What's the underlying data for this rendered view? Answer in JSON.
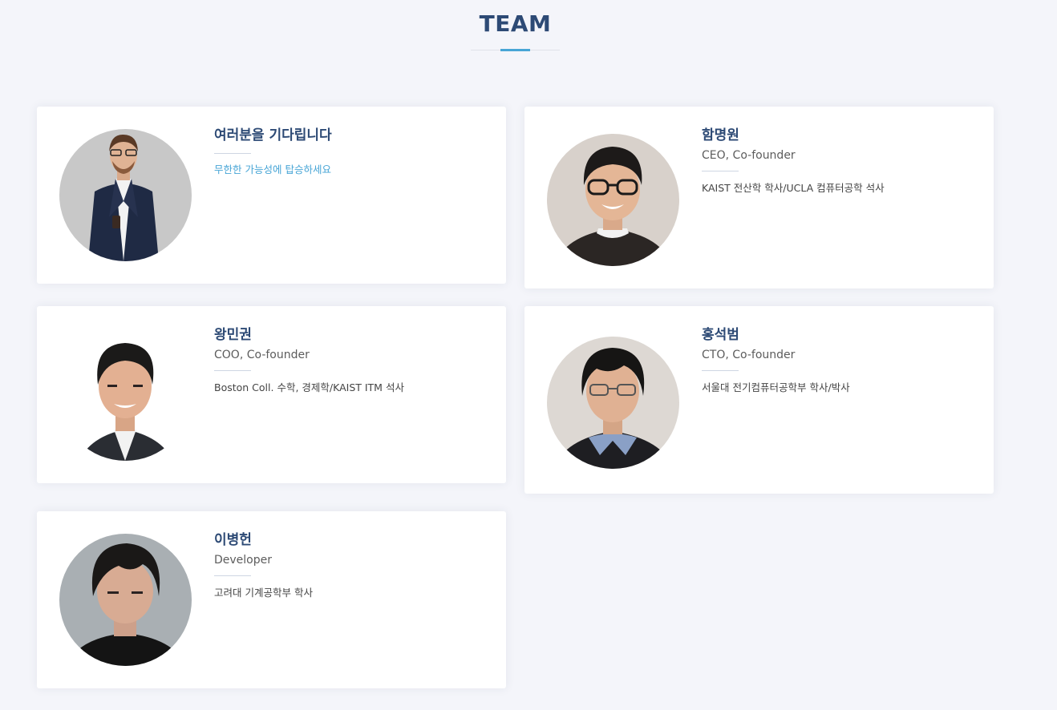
{
  "section": {
    "title": "TEAM"
  },
  "members": [
    {
      "name": "여러분을 기다립니다",
      "role": "",
      "desc": "무한한 가능성에 탑승하세요"
    },
    {
      "name": "함명원",
      "role": "CEO, Co-founder",
      "desc": "KAIST 전산학 학사/UCLA 컴퓨터공학 석사"
    },
    {
      "name": "왕민권",
      "role": "COO, Co-founder",
      "desc": "Boston Coll. 수학, 경제학/KAIST ITM 석사"
    },
    {
      "name": "홍석범",
      "role": "CTO, Co-founder",
      "desc": "서울대 전기컴퓨터공학부 학사/박사"
    },
    {
      "name": "이병헌",
      "role": "Developer",
      "desc": "고려대 기계공학부 학사"
    }
  ],
  "colors": {
    "title": "#2d4a75",
    "accent": "#47a5d6",
    "background": "#f4f5fa"
  }
}
